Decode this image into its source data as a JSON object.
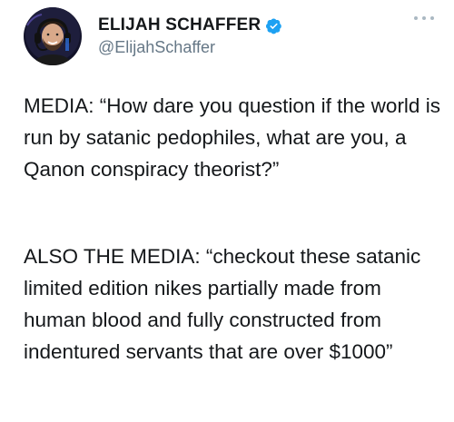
{
  "tweet": {
    "author": {
      "display_name": "ELIJAH SCHAFFER",
      "handle": "@ElijahSchaffer",
      "avatar_icon": "profile-photo-headset-icon",
      "verified": true
    },
    "more_icon": "more-options-icon",
    "paragraphs": [
      "MEDIA: “How dare you question if the world is run by satanic pedophiles, what are you, a Qanon conspiracy theorist?”",
      "ALSO THE MEDIA: “checkout these satanic limited edition nikes partially made from human blood and fully constructed from indentured servants that are over $1000”"
    ]
  },
  "colors": {
    "verified_blue": "#1da1f2",
    "handle_gray": "#657786",
    "text": "#14171a"
  }
}
